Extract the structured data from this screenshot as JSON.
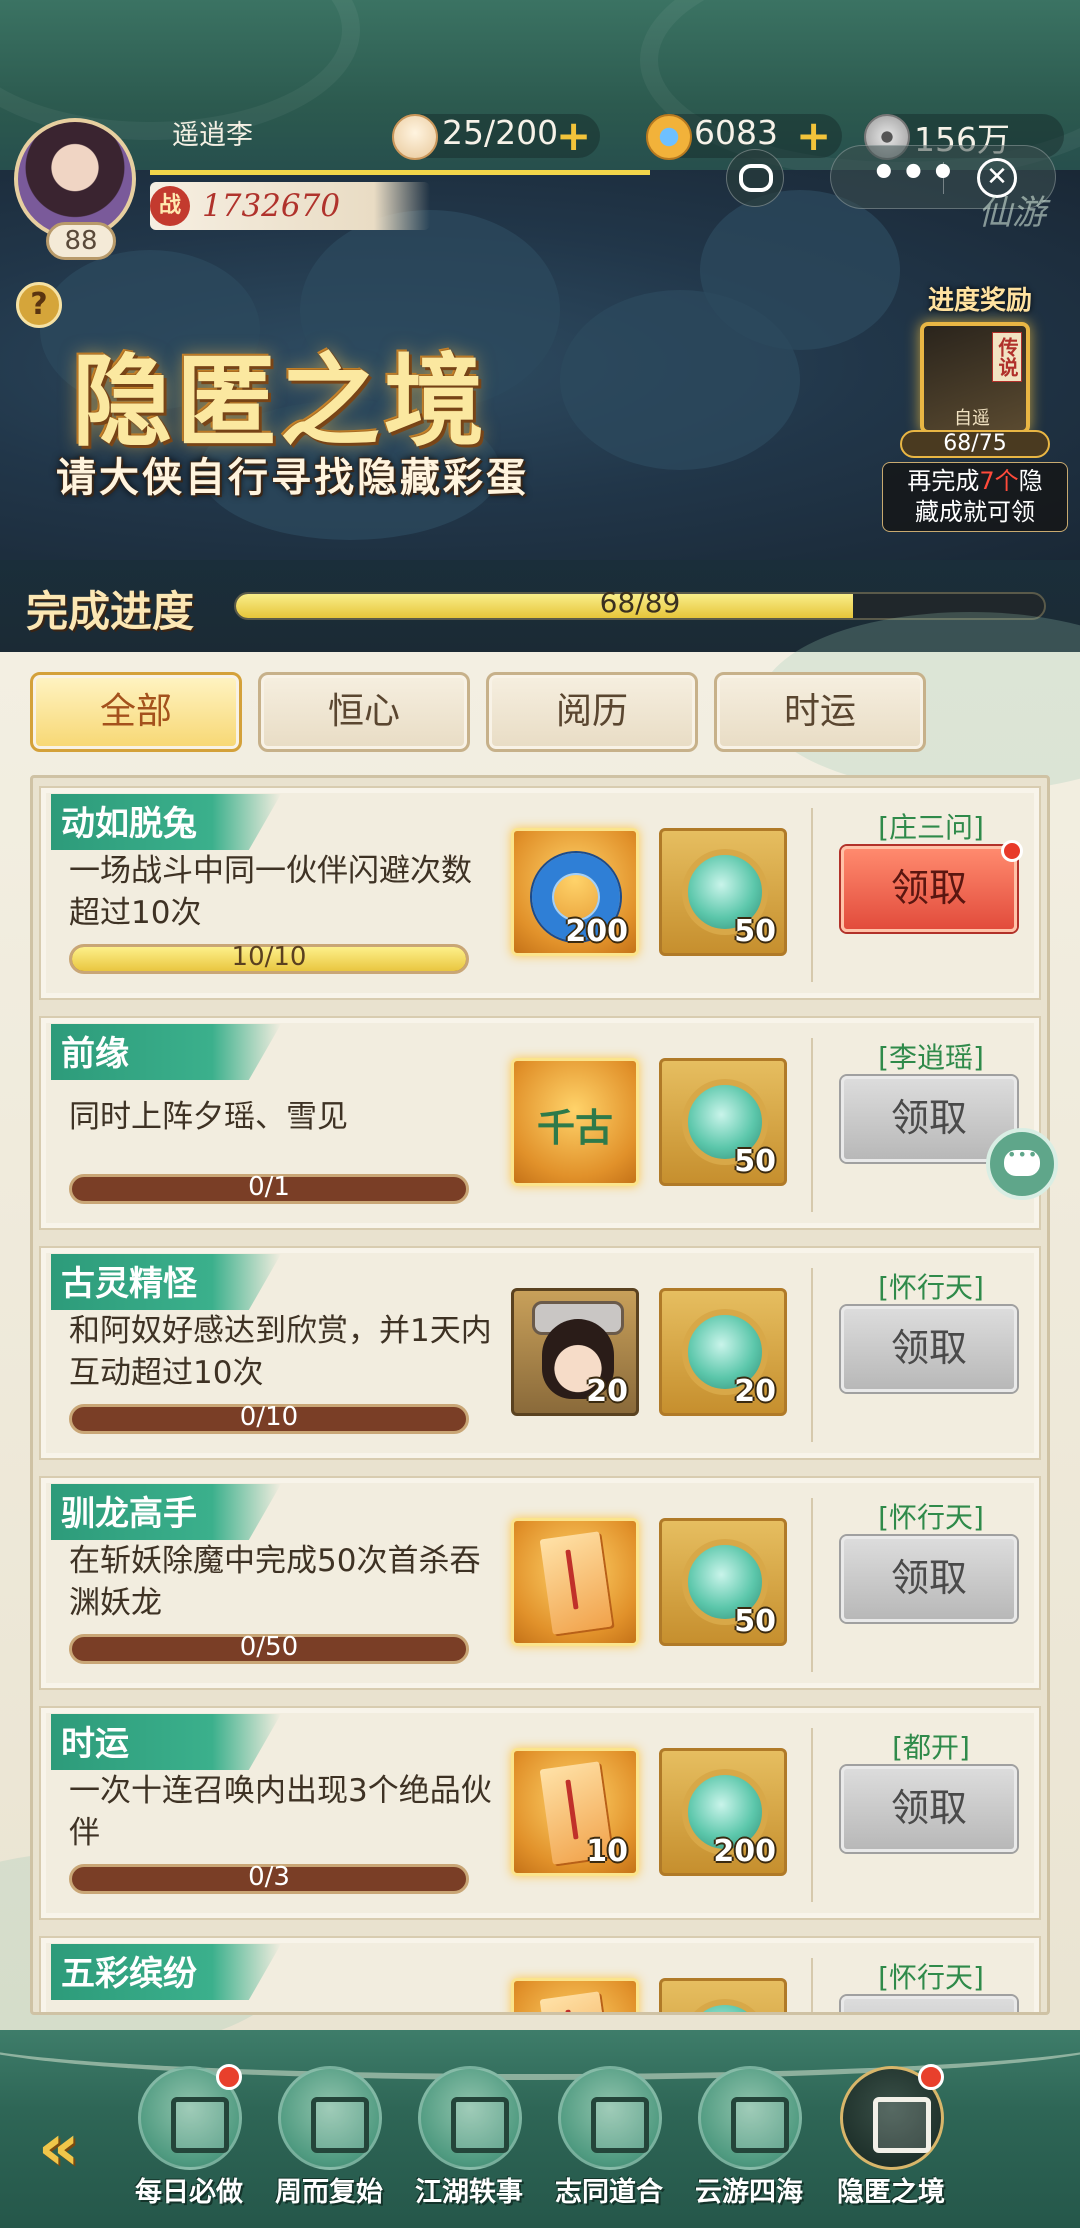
{
  "header": {
    "player_name": "遥逍李",
    "level": "88",
    "power_icon": "战",
    "power": "1732670",
    "stamina": "25/200",
    "gold": "6083",
    "silver": "156万",
    "corner_text": "仙游",
    "capsule_more": "•••",
    "capsule_close": "✕"
  },
  "banner": {
    "help": "?",
    "title": "隐匿之境",
    "subtitle": "请大侠自行寻找隐藏彩蛋",
    "reward_title": "进度奖励",
    "reward_tag": "传说",
    "reward_name": "自遥",
    "reward_count": "68/75",
    "reward_desc_pre": "再完成",
    "reward_desc_num": "7个",
    "reward_desc_mid": "隐",
    "reward_desc_post": "藏成就可领"
  },
  "progress": {
    "label": "完成进度",
    "text": "68/89",
    "fraction": 0.764
  },
  "tabs": [
    {
      "label": "全部",
      "active": true
    },
    {
      "label": "恒心",
      "active": false
    },
    {
      "label": "阅历",
      "active": false
    },
    {
      "label": "时运",
      "active": false
    }
  ],
  "tasks": [
    {
      "title": "动如脱兔",
      "desc": "一场战斗中同一伙伴闪避次数超过10次",
      "progress_text": "10/10",
      "progress": 1.0,
      "reward1_kind": "ring",
      "reward1_count": "200",
      "reward2_count": "50",
      "npc": "[庄三问]",
      "claim": "领取",
      "claimable": true
    },
    {
      "title": "前缘",
      "desc": "同时上阵夕瑶、雪见",
      "progress_text": "0/1",
      "progress": 0,
      "reward1_kind": "qiangu",
      "reward1_text": "千古",
      "reward1_count": "",
      "reward2_count": "50",
      "npc": "[李逍瑶]",
      "claim": "领取",
      "claimable": false
    },
    {
      "title": "古灵精怪",
      "desc": "和阿奴好感达到欣赏，并1天内互动超过10次",
      "progress_text": "0/10",
      "progress": 0,
      "reward1_kind": "portrait",
      "reward1_count": "20",
      "reward2_count": "20",
      "npc": "[怀行天]",
      "claim": "领取",
      "claimable": false
    },
    {
      "title": "驯龙高手",
      "desc": "在斩妖除魔中完成50次首杀吞渊妖龙",
      "progress_text": "0/50",
      "progress": 0,
      "reward1_kind": "scroll",
      "reward1_count": "",
      "reward2_count": "50",
      "npc": "[怀行天]",
      "claim": "领取",
      "claimable": false
    },
    {
      "title": "时运",
      "desc": "一次十连召唤内出现3个绝品伙伴",
      "progress_text": "0/3",
      "progress": 0,
      "reward1_kind": "scroll",
      "reward1_count": "10",
      "reward2_count": "200",
      "npc": "[都开]",
      "claim": "领取",
      "claimable": false
    },
    {
      "title": "五彩缤纷",
      "desc": "",
      "progress_text": "",
      "progress": 0,
      "reward1_kind": "scroll",
      "reward1_count": "",
      "reward2_count": "",
      "npc": "[怀行天]",
      "claim": "",
      "claimable": false
    }
  ],
  "nav": [
    {
      "label": "每日必做",
      "dot": true,
      "active": false,
      "icon": "daily-calendar-icon"
    },
    {
      "label": "周而复始",
      "dot": false,
      "active": false,
      "icon": "weekly-calendar-icon"
    },
    {
      "label": "江湖轶事",
      "dot": false,
      "active": false,
      "icon": "scroll-icon"
    },
    {
      "label": "志同道合",
      "dot": false,
      "active": false,
      "icon": "friends-icon"
    },
    {
      "label": "云游四海",
      "dot": false,
      "active": false,
      "icon": "boat-icon"
    },
    {
      "label": "隐匿之境",
      "dot": true,
      "active": true,
      "icon": "hidden-scroll-icon"
    }
  ],
  "colors": {
    "accent": "#2d9b7a",
    "gold": "#e9c640",
    "claim_active": "#e24c3c"
  }
}
